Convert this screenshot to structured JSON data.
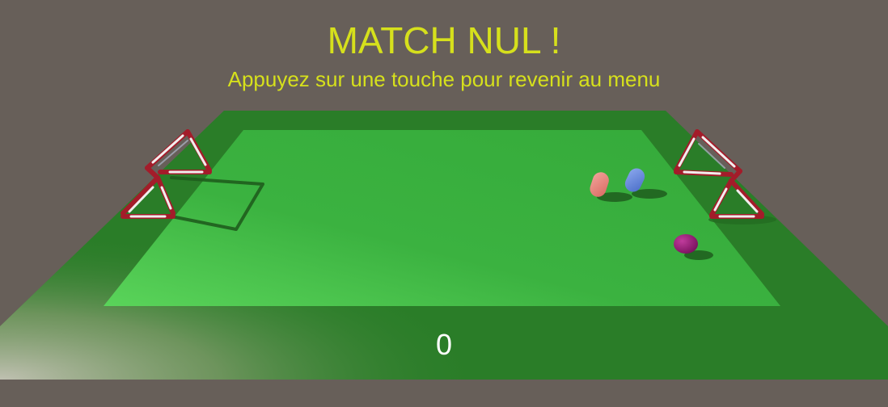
{
  "hud": {
    "title": "MATCH NUL !",
    "subtitle": "Appuyez sur une touche pour revenir au menu",
    "score": "0"
  },
  "colors": {
    "background": "#675f59",
    "text_accent": "#d6e01c",
    "text_score": "#ffffff",
    "pitch_outer": "#2a7d28",
    "pitch_inner": "#3bb240",
    "goal_red": "#a31c2a",
    "goal_white": "#f1eeee",
    "player_red": "#e57d75",
    "player_blue": "#5a80d8",
    "ball": "#8c1a70"
  },
  "objects": {
    "goals": [
      "goal-left",
      "goal-right"
    ],
    "players": [
      "player-red",
      "player-blue"
    ],
    "ball": "ball"
  }
}
